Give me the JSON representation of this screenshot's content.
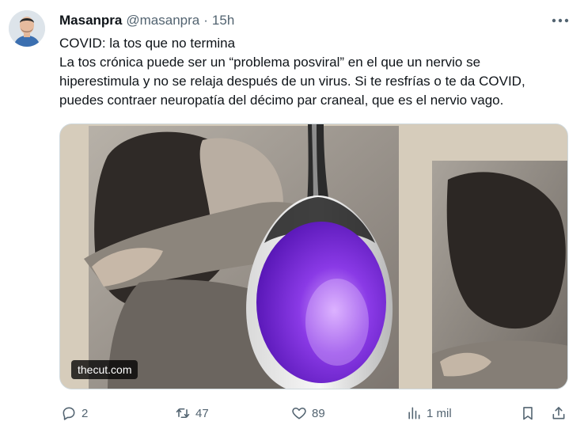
{
  "tweet": {
    "author_name": "Masanpra",
    "author_handle": "@masanpra",
    "separator": "·",
    "time": "15h",
    "text_lines": [
      "COVID: la tos que no termina",
      "La tos crónica puede ser un “problema posviral” en el que un nervio se",
      "hiperestimula y no se relaja después de un virus. Si te resfrías o te da COVID,",
      "puedes contraer neuropatía del décimo par craneal, que es el nervio vago."
    ],
    "card": {
      "source": "thecut.com"
    },
    "counts": {
      "replies": "2",
      "retweets": "47",
      "likes": "89",
      "views": "1 mil"
    }
  },
  "icons": {
    "more": "more-horizontal-icon",
    "reply": "reply-icon",
    "retweet": "retweet-icon",
    "like": "heart-icon",
    "views": "analytics-icon",
    "bookmark": "bookmark-icon",
    "share": "share-icon"
  },
  "colors": {
    "text_primary": "#0f1419",
    "text_secondary": "#536471",
    "border": "#cfd9de",
    "spoon_purple": "#7a2ad8"
  }
}
